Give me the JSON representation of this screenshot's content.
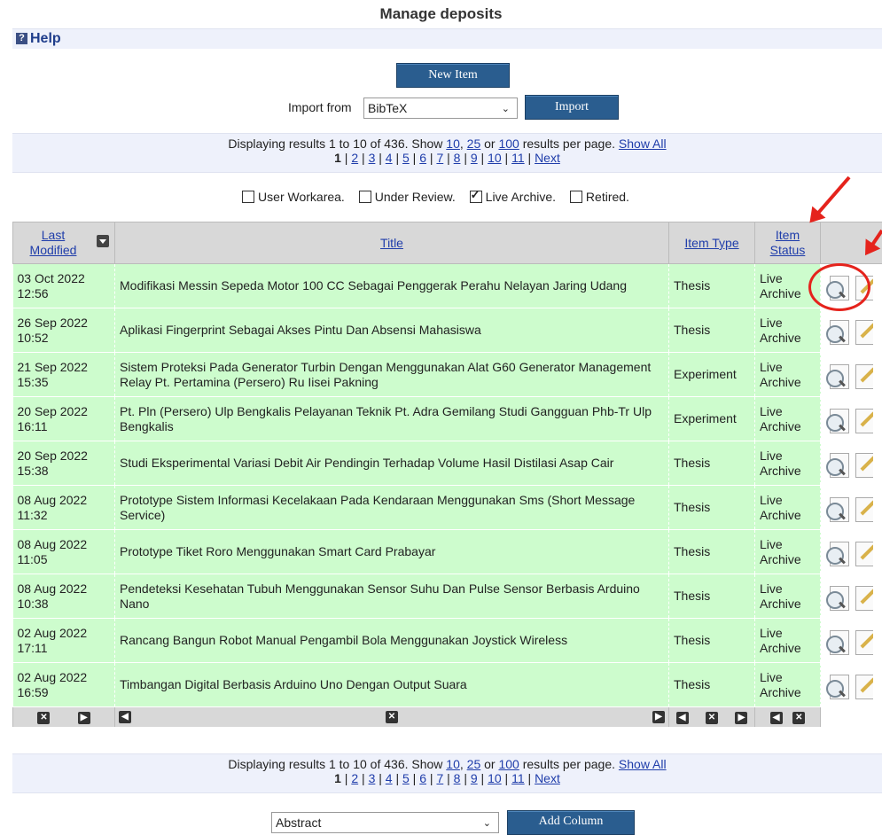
{
  "page": {
    "title": "Manage deposits",
    "help_label": "Help"
  },
  "actions": {
    "new_item_label": "New Item",
    "import_from_label": "Import from",
    "import_format": "BibTeX",
    "import_label": "Import"
  },
  "paging": {
    "summary_prefix": "Displaying results 1 to 10 of 436. Show",
    "opt_10": "10",
    "comma": ",",
    "opt_25": "25",
    "or": "or",
    "opt_100": "100",
    "suffix": "results per page.",
    "show_all": "Show All",
    "current_page": "1",
    "pages": [
      "2",
      "3",
      "4",
      "5",
      "6",
      "7",
      "8",
      "9",
      "10",
      "11"
    ],
    "next_label": "Next"
  },
  "filters": [
    {
      "label": "User Workarea.",
      "checked": false
    },
    {
      "label": "Under Review.",
      "checked": false
    },
    {
      "label": "Live Archive.",
      "checked": true
    },
    {
      "label": "Retired.",
      "checked": false
    }
  ],
  "table": {
    "headers": {
      "last_modified": "Last Modified",
      "title": "Title",
      "item_type": "Item Type",
      "item_status": "Item Status"
    },
    "rows": [
      {
        "date": "03 Oct 2022",
        "time": "12:56",
        "title": "Modifikasi Messin Sepeda Motor 100 CC Sebagai Penggerak Perahu Nelayan Jaring Udang",
        "type": "Thesis",
        "status": "Live Archive"
      },
      {
        "date": "26 Sep 2022",
        "time": "10:52",
        "title": "Aplikasi Fingerprint Sebagai Akses Pintu Dan Absensi Mahasiswa",
        "type": "Thesis",
        "status": "Live Archive"
      },
      {
        "date": "21 Sep 2022",
        "time": "15:35",
        "title": "Sistem Proteksi Pada Generator Turbin Dengan Menggunakan Alat G60 Generator Management Relay Pt. Pertamina (Persero) Ru Iisei Pakning",
        "type": "Experiment",
        "status": "Live Archive"
      },
      {
        "date": "20 Sep 2022",
        "time": "16:11",
        "title": "Pt. Pln (Persero) Ulp Bengkalis Pelayanan Teknik Pt. Adra Gemilang Studi Gangguan Phb-Tr Ulp Bengkalis",
        "type": "Experiment",
        "status": "Live Archive"
      },
      {
        "date": "20 Sep 2022",
        "time": "15:38",
        "title": "Studi Eksperimental Variasi Debit Air Pendingin Terhadap Volume Hasil Distilasi Asap Cair",
        "type": "Thesis",
        "status": "Live Archive"
      },
      {
        "date": "08 Aug 2022",
        "time": "11:32",
        "title": "Prototype Sistem Informasi Kecelakaan Pada Kendaraan Menggunakan Sms (Short Message Service)",
        "type": "Thesis",
        "status": "Live Archive"
      },
      {
        "date": "08 Aug 2022",
        "time": "11:05",
        "title": "Prototype Tiket Roro Menggunakan Smart Card Prabayar",
        "type": "Thesis",
        "status": "Live Archive"
      },
      {
        "date": "08 Aug 2022",
        "time": "10:38",
        "title": "Pendeteksi Kesehatan Tubuh Menggunakan Sensor Suhu Dan Pulse Sensor Berbasis Arduino Nano",
        "type": "Thesis",
        "status": "Live Archive"
      },
      {
        "date": "02 Aug 2022",
        "time": "17:11",
        "title": "Rancang Bangun Robot Manual Pengambil Bola Menggunakan Joystick Wireless",
        "type": "Thesis",
        "status": "Live Archive"
      },
      {
        "date": "02 Aug 2022",
        "time": "16:59",
        "title": "Timbangan Digital Berbasis Arduino Uno Dengan Output Suara",
        "type": "Thesis",
        "status": "Live Archive"
      }
    ]
  },
  "column_add": {
    "selected": "Abstract",
    "button_label": "Add Column"
  },
  "icons": {
    "help": "help-icon",
    "sort": "sort-desc-icon",
    "view": "view-magnifier-icon",
    "edit": "edit-pencil-icon",
    "remove": "remove-column-icon",
    "move_left": "move-left-icon",
    "move_right": "move-right-icon"
  },
  "colors": {
    "row_bg": "#cdfccd",
    "header_bg": "#d8d8d8",
    "button_bg": "#2a5d8f",
    "annotation": "#e5231c"
  }
}
